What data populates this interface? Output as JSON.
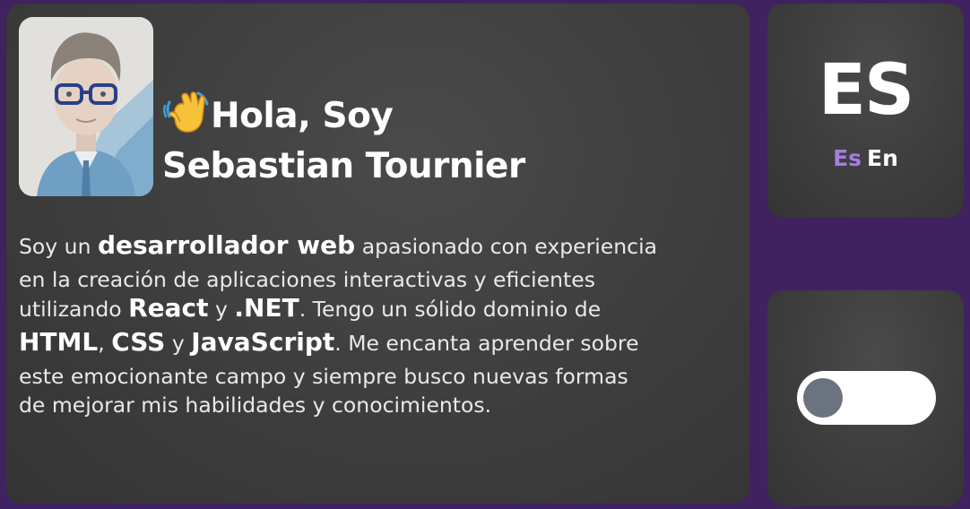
{
  "profile": {
    "greeting_line1": "Hola, Soy",
    "greeting_line2": "Sebastian Tournier",
    "bio": {
      "l1_a": "Soy un ",
      "l1_b": "desarrollador web",
      "l1_c": " apasionado con experiencia",
      "l2": "en la creación de aplicaciones interactivas y eficientes",
      "l3_a": "utilizando ",
      "l3_b": "React",
      "l3_c": " y ",
      "l3_d": ".NET",
      "l3_e": ". Tengo un sólido dominio de",
      "l4_a": "HTML",
      "l4_b": ", ",
      "l4_c": "CSS",
      "l4_d": " y ",
      "l4_e": "JavaScript",
      "l4_f": ". Me encanta aprender sobre",
      "l5": "este emocionante campo y siempre busco nuevas formas",
      "l6": "de mejorar mis habilidades y conocimientos."
    }
  },
  "language": {
    "current": "ES",
    "option_es": "Es",
    "option_en": "En",
    "active_color": "#a77bdf"
  },
  "theme_toggle": {
    "state": "off",
    "knob_color": "#6b7280"
  },
  "colors": {
    "background": "#3f225f",
    "card": "#3d3d3d"
  }
}
